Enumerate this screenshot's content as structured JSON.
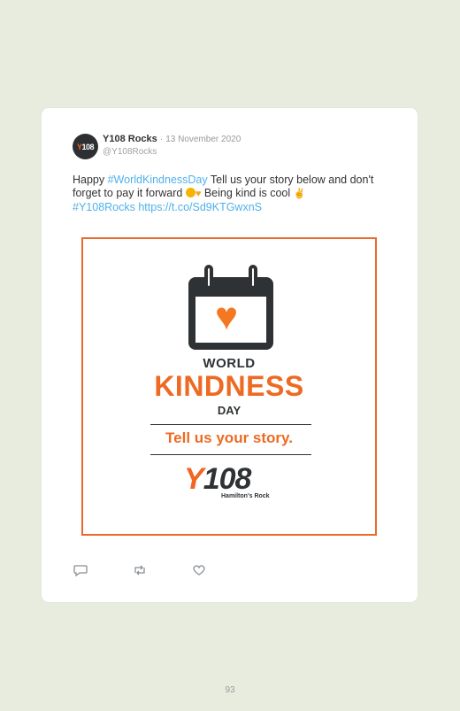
{
  "tweet": {
    "avatar_text": "Y108",
    "author_name": "Y108 Rocks",
    "separator": "·",
    "date": "13 November 2020",
    "handle": "@Y108Rocks",
    "text_prefix": "Happy ",
    "hashtag1": "#WorldKindnessDay",
    "text_mid": " Tell us your story below and don't forget to pay it forward ",
    "text_mid2": " Being kind is cool ",
    "hashtag2": "#Y108Rocks",
    "link": "https://t.co/Sd9KTGwxnS"
  },
  "media": {
    "line1": "WORLD",
    "line2": "KINDNESS",
    "line3": "DAY",
    "tagline": "Tell us your story.",
    "logo_y": "Y",
    "logo_num": "108",
    "logo_sub": "Hamilton's Rock",
    "accent_color": "#ee6a22",
    "dark_color": "#2f3235"
  },
  "actions": [
    "reply-icon",
    "retweet-icon",
    "like-icon"
  ],
  "page_number": "93"
}
